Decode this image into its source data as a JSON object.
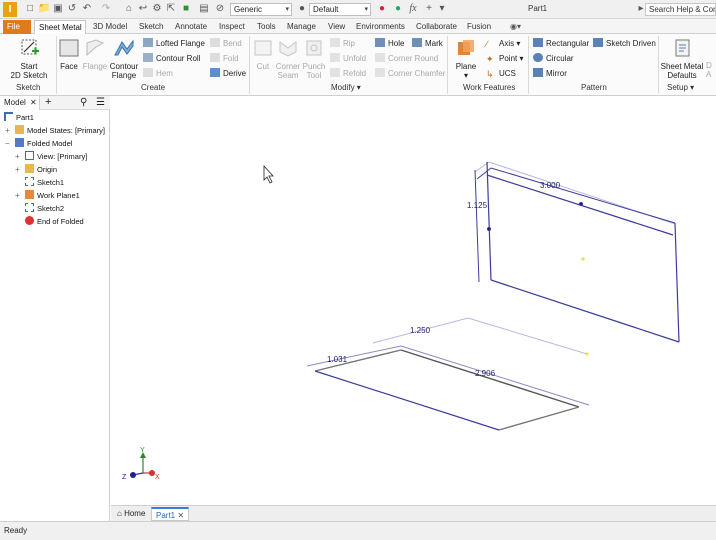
{
  "app": {
    "logo_letter": "I",
    "document_title": "Part1"
  },
  "quick_access": {
    "appearance_combo": "Generic",
    "material_combo": "Default",
    "fx_label": "fx",
    "search_placeholder": "Search Help & Com"
  },
  "tabs": [
    "File",
    "Sheet Metal",
    "3D Model",
    "Sketch",
    "Annotate",
    "Inspect",
    "Tools",
    "Manage",
    "View",
    "Environments",
    "Collaborate",
    "Fusion"
  ],
  "active_tab": "Sheet Metal",
  "ribbon": {
    "sketch": {
      "title": "Sketch",
      "start_sketch": "Start\n2D Sketch"
    },
    "create": {
      "title": "Create",
      "face": "Face",
      "flange": "Flange",
      "contour_flange": "Contour\nFlange",
      "lofted_flange": "Lofted Flange",
      "contour_roll": "Contour Roll",
      "hem": "Hem",
      "bend": "Bend",
      "fold": "Fold",
      "derive": "Derive"
    },
    "modify": {
      "title": "Modify",
      "cut": "Cut",
      "corner_seam": "Corner\nSeam",
      "punch_tool": "Punch\nTool",
      "rip": "Rip",
      "unfold": "Unfold",
      "refold": "Refold",
      "hole": "Hole",
      "corner_round": "Corner Round",
      "corner_chamfer": "Corner Chamfer",
      "mark": "Mark"
    },
    "work_features": {
      "title": "Work Features",
      "plane": "Plane",
      "axis": "Axis",
      "point": "Point",
      "ucs": "UCS"
    },
    "pattern": {
      "title": "Pattern",
      "rectangular": "Rectangular",
      "circular": "Circular",
      "mirror": "Mirror",
      "sketch_driven": "Sketch Driven"
    },
    "setup": {
      "title": "Setup",
      "sheet_metal_defaults": "Sheet Metal\nDefaults",
      "cut_label": "D\nA"
    }
  },
  "browser": {
    "tab_label": "Model",
    "nodes": [
      {
        "label": "Part1",
        "icon": "part-icon"
      },
      {
        "label": "Model States: [Primary]",
        "icon": "folder-icon"
      },
      {
        "label": "Folded Model",
        "icon": "sheetmetal-icon"
      },
      {
        "label": "View: [Primary]",
        "icon": "view-icon"
      },
      {
        "label": "Origin",
        "icon": "folder-icon"
      },
      {
        "label": "Sketch1",
        "icon": "sketch-icon"
      },
      {
        "label": "Work Plane1",
        "icon": "workplane-icon"
      },
      {
        "label": "Sketch2",
        "icon": "sketch-icon"
      },
      {
        "label": "End of Folded",
        "icon": "end-of-part-icon"
      }
    ]
  },
  "viewport": {
    "dimensions": {
      "d1": "3.000",
      "d2": "1.125",
      "d3": "1.250",
      "d4": "1.031",
      "d5": "2.906"
    },
    "triad": {
      "x": "X",
      "y": "Y",
      "z": "Z"
    },
    "colors": {
      "sketch_line": "#3c3ca0",
      "selected_point": "#f0e040"
    }
  },
  "doc_tabs": {
    "home": "Home",
    "part": "Part1"
  },
  "status": {
    "text": "Ready"
  }
}
